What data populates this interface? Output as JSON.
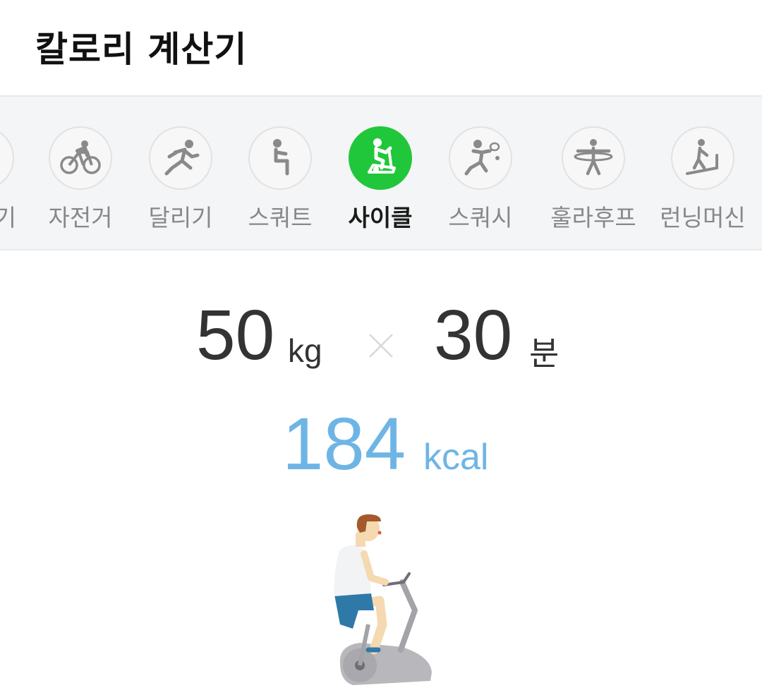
{
  "header": {
    "title": "칼로리 계산기"
  },
  "tabs": [
    {
      "label": "기",
      "icon": "partial-exercise-icon",
      "active": false
    },
    {
      "label": "자전거",
      "icon": "bicycle-icon",
      "active": false
    },
    {
      "label": "달리기",
      "icon": "running-icon",
      "active": false
    },
    {
      "label": "스쿼트",
      "icon": "squat-icon",
      "active": false
    },
    {
      "label": "사이클",
      "icon": "exercise-bike-icon",
      "active": true
    },
    {
      "label": "스쿼시",
      "icon": "squash-icon",
      "active": false
    },
    {
      "label": "훌라후프",
      "icon": "hula-hoop-icon",
      "active": false
    },
    {
      "label": "런닝머신",
      "icon": "treadmill-icon",
      "active": false
    }
  ],
  "colors": {
    "active_tab": "#21c73a",
    "kcal": "#6eb5e5",
    "tab_bar_bg": "#f3f5f6"
  },
  "calculation": {
    "weight_value": "50",
    "weight_unit": "kg",
    "duration_value": "30",
    "duration_unit": "분",
    "calories_value": "184",
    "calories_unit": "kcal"
  },
  "illustration": {
    "icon": "person-on-exercise-bike-illustration"
  }
}
